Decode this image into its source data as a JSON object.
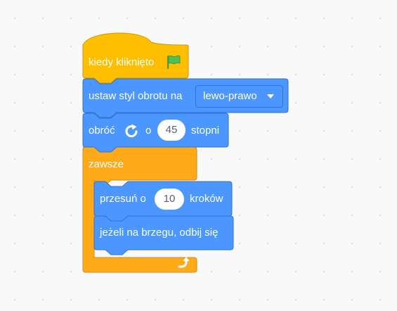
{
  "script": {
    "hat_block": {
      "label": "kiedy kliknięto",
      "icon": "green-flag-icon"
    },
    "rotation_style_block": {
      "label": "ustaw styl obrotu na",
      "dropdown_value": "lewo-prawo"
    },
    "turn_block": {
      "label_before": "obróć",
      "turn_icon": "rotate-clockwise-icon",
      "label_mid": "o",
      "degrees": "45",
      "label_after": "stopni"
    },
    "forever_block": {
      "label": "zawsze",
      "loop_icon": "loop-arrow-icon"
    },
    "move_block": {
      "label_before": "przesuń o",
      "steps": "10",
      "label_after": "kroków"
    },
    "bounce_block": {
      "label": "jeżeli na brzegu, odbij się"
    }
  },
  "colors": {
    "events": "#ffbf00",
    "events_border": "#cc9900",
    "control": "#ffab19",
    "control_border": "#cf8b17",
    "motion": "#4c97ff",
    "motion_border": "#3373cc"
  }
}
